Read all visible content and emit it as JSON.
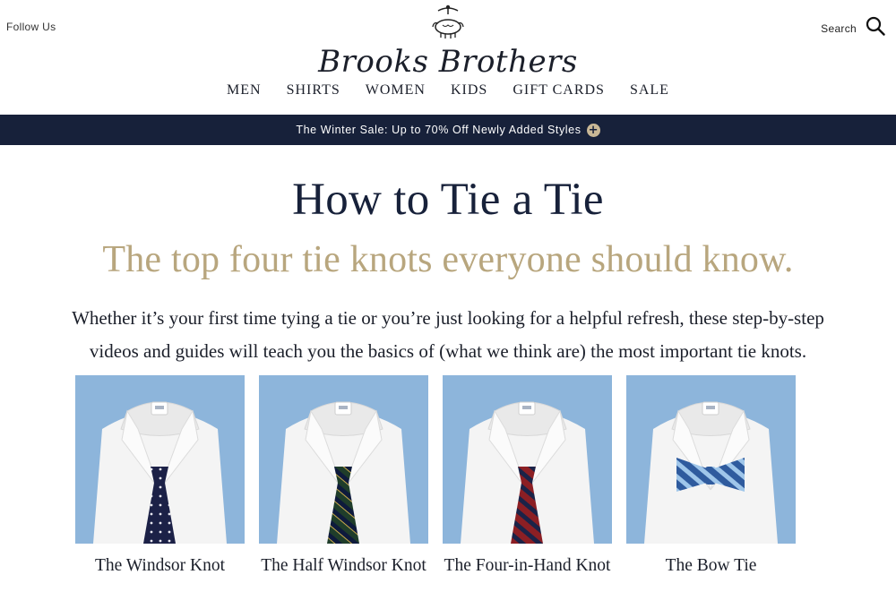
{
  "header": {
    "follow_label": "Follow Us",
    "search_label": "Search",
    "logo_text": "Brooks Brothers"
  },
  "nav": [
    "MEN",
    "SHIRTS",
    "WOMEN",
    "KIDS",
    "GIFT CARDS",
    "SALE"
  ],
  "banner": {
    "text": "The Winter Sale: Up to 70% Off Newly Added Styles",
    "icon": "plus-circle-icon"
  },
  "page": {
    "title": "How to Tie a Tie",
    "subtitle": "The top four tie knots everyone should know.",
    "intro_line1": "Whether it’s your first time tying a tie or you’re just looking for a helpful refresh, these step-by-step",
    "intro_line2": "videos and guides will teach you the basics of (what we think are) the most important tie knots."
  },
  "cards": [
    {
      "title": "The Windsor Knot",
      "tie": "navy-dot"
    },
    {
      "title": "The Half Windsor Knot",
      "tie": "green-stripe"
    },
    {
      "title": "The Four-in-Hand Knot",
      "tie": "red-stripe"
    },
    {
      "title": "The Bow Tie",
      "tie": "blue-bow"
    }
  ],
  "colors": {
    "banner_bg": "#17213a",
    "subtitle": "#b8a67e",
    "backdrop": "#89b2d8"
  }
}
